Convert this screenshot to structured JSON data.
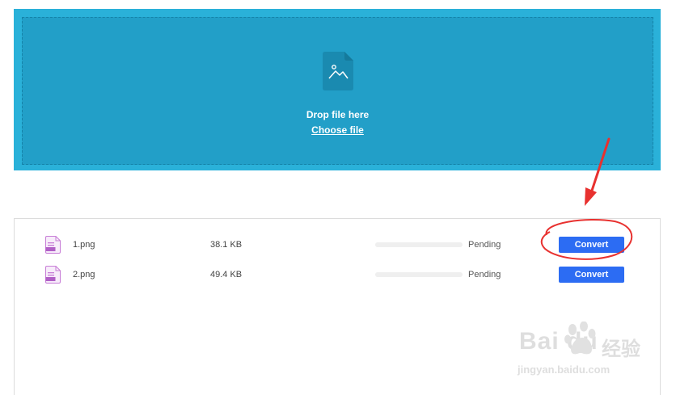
{
  "dropzone": {
    "drop_text": "Drop file here",
    "choose_text": "Choose file",
    "icon": "image-file-icon",
    "colors": {
      "outer": "#2ab1d9",
      "inner": "#229fc8"
    }
  },
  "files": [
    {
      "name": "1.png",
      "size": "38.1 KB",
      "progress": 0,
      "status": "Pending",
      "action": "Convert"
    },
    {
      "name": "2.png",
      "size": "49.4 KB",
      "progress": 0,
      "status": "Pending",
      "action": "Convert"
    }
  ],
  "watermark": {
    "logo": "Bai du",
    "brand": "经验",
    "url": "jingyan.baidu.com"
  },
  "annotation": {
    "color": "#e8312f",
    "icon": "red-arrow-and-circle-annotation"
  },
  "colors": {
    "accent": "#2c6cf3",
    "file_icon": "#c77dd6"
  }
}
